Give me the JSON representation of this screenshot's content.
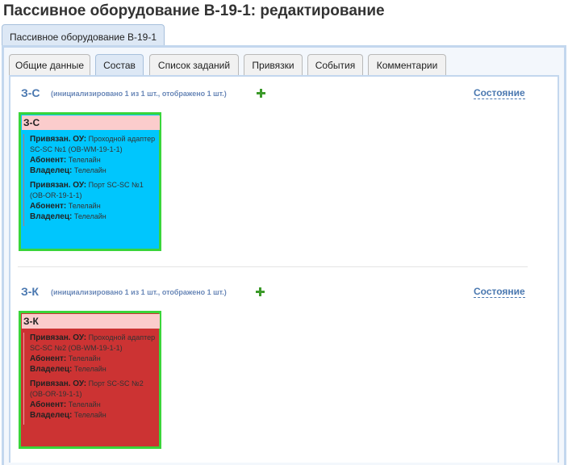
{
  "page": {
    "title": "Пассивное оборудование В-19-1: редактирование"
  },
  "outer_tab": {
    "label": "Пассивное оборудование В-19-1"
  },
  "tabs": [
    {
      "label": "Общие данные"
    },
    {
      "label": "Состав"
    },
    {
      "label": "Список заданий"
    },
    {
      "label": "Привязки"
    },
    {
      "label": "События"
    },
    {
      "label": "Комментарии"
    }
  ],
  "active_tab": "Состав",
  "labels": {
    "bound": "Привязан. ОУ:",
    "subscriber": "Абонент:",
    "owner": "Владелец:"
  },
  "sections": [
    {
      "code": "З-С",
      "info": "(инициализировано 1 из 1 шт., отображено 1 шт.)",
      "state_label": "Состояние",
      "card": {
        "title": "З-С",
        "color": "#00c6fd",
        "entries": [
          {
            "unit": "Проходной адаптер SC-SC №1 (OB-WM-19-1-1)",
            "subscriber": "Телелайн",
            "owner": "Телелайн"
          },
          {
            "unit": "Порт SC-SC №1 (OB-OR-19-1-1)",
            "subscriber": "Телелайн",
            "owner": "Телелайн"
          }
        ]
      }
    },
    {
      "code": "З-К",
      "info": "(инициализировано 1 из 1 шт., отображено 1 шт.)",
      "state_label": "Состояние",
      "card": {
        "title": "З-К",
        "color": "#cc3333",
        "entries": [
          {
            "unit": "Проходной адаптер SC-SC №2 (OB-WM-19-1-1)",
            "subscriber": "Телелайн",
            "owner": "Телелайн"
          },
          {
            "unit": "Порт SC-SC №2 (OB-OR-19-1-1)",
            "subscriber": "Телелайн",
            "owner": "Телелайн"
          }
        ]
      }
    }
  ],
  "colors": {
    "card_border": "#3ad53a",
    "card_header": "#fbcccc",
    "accent": "#4a78b0",
    "add_icon": "#3c9a2a"
  },
  "icons": {
    "add": "plus-icon"
  }
}
